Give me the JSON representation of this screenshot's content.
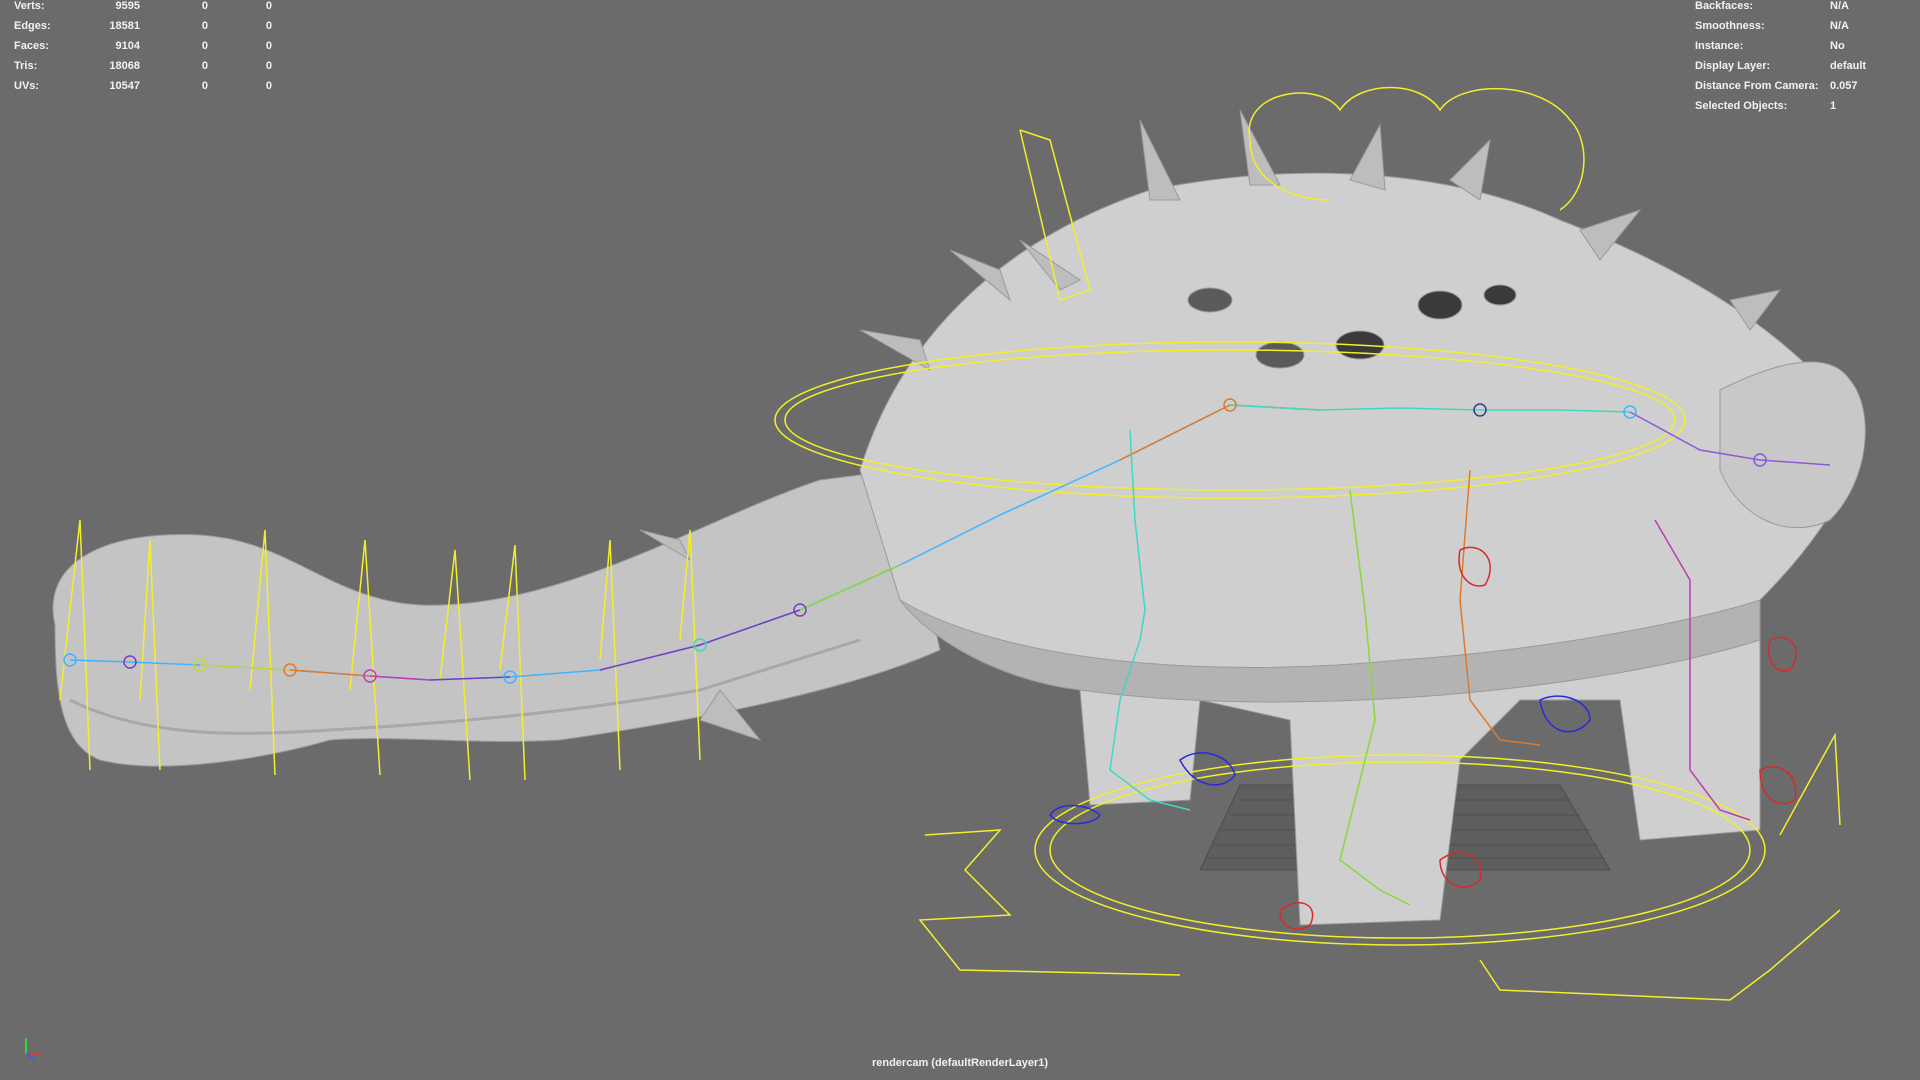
{
  "hud_left": {
    "rows": [
      {
        "label": "Verts:",
        "v1": "9595",
        "v2": "0",
        "v3": "0"
      },
      {
        "label": "Edges:",
        "v1": "18581",
        "v2": "0",
        "v3": "0"
      },
      {
        "label": "Faces:",
        "v1": "9104",
        "v2": "0",
        "v3": "0"
      },
      {
        "label": "Tris:",
        "v1": "18068",
        "v2": "0",
        "v3": "0"
      },
      {
        "label": "UVs:",
        "v1": "10547",
        "v2": "0",
        "v3": "0"
      }
    ]
  },
  "hud_right": {
    "rows": [
      {
        "label": "Backfaces:",
        "value": "N/A"
      },
      {
        "label": "Smoothness:",
        "value": "N/A"
      },
      {
        "label": "Instance:",
        "value": "No"
      },
      {
        "label": "Display Layer:",
        "value": "default"
      },
      {
        "label": "Distance From Camera:",
        "value": "0.057"
      },
      {
        "label": "Selected Objects:",
        "value": "1"
      }
    ]
  },
  "camera_label": "rendercam (defaultRenderLayer1)",
  "colors": {
    "background": "#6b6b6b",
    "mesh": "#cfcfcf",
    "controls": "#f2ef2a",
    "hud_text": "#f2f2f2"
  },
  "icons": [
    "axis-gizmo-icon"
  ]
}
